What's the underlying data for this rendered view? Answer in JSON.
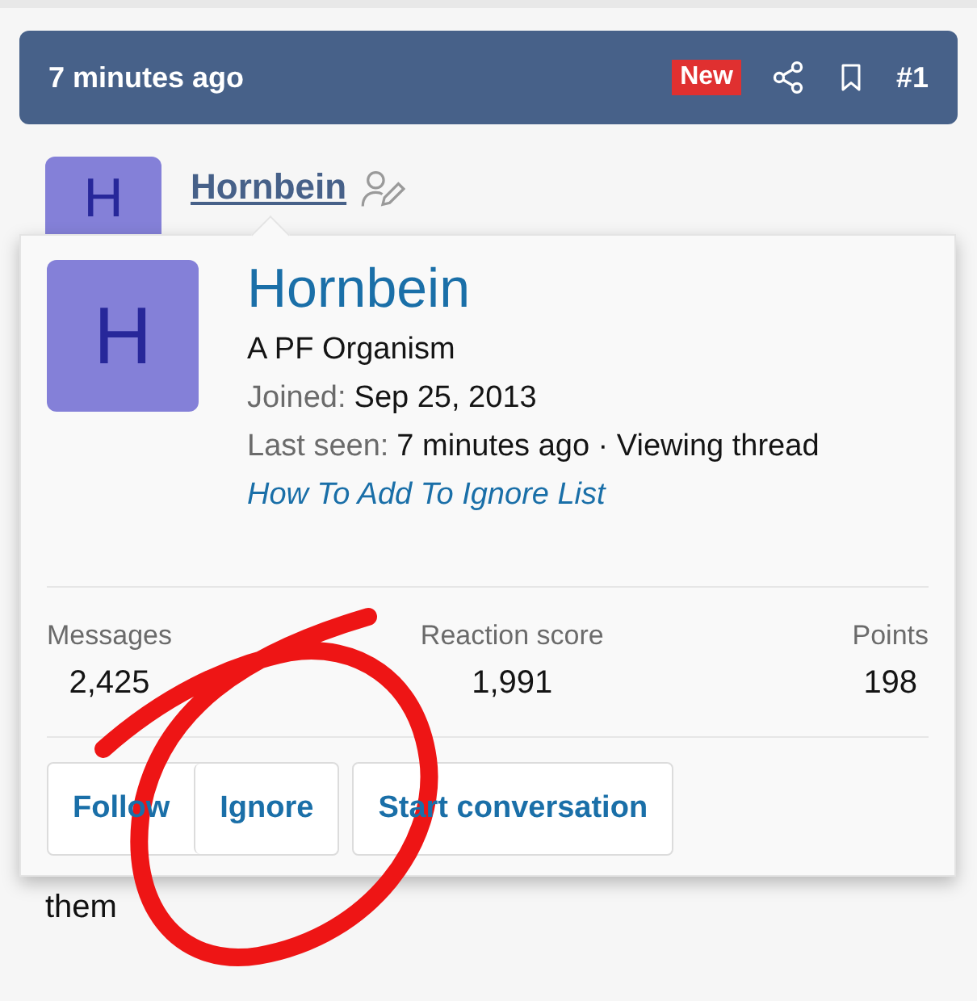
{
  "post_header": {
    "time": "7 minutes ago",
    "badge": "New",
    "number": "#1"
  },
  "author": {
    "name": "Hornbein",
    "avatar_letter": "H"
  },
  "popup": {
    "avatar_letter": "H",
    "name": "Hornbein",
    "title": "A PF Organism",
    "facts": [
      {
        "label": "Joined:",
        "value": "Sep 25, 2013"
      },
      {
        "label": "Last seen:",
        "value": "7 minutes ago · Viewing thread"
      }
    ],
    "link": "How To Add To Ignore List",
    "stats": [
      {
        "label": "Messages",
        "value": "2,425"
      },
      {
        "label": "Reaction score",
        "value": "1,991"
      },
      {
        "label": "Points",
        "value": "198"
      }
    ],
    "button_groups": [
      [
        "Follow",
        "Ignore"
      ],
      [
        "Start conversation"
      ]
    ]
  },
  "post_text": "them"
}
